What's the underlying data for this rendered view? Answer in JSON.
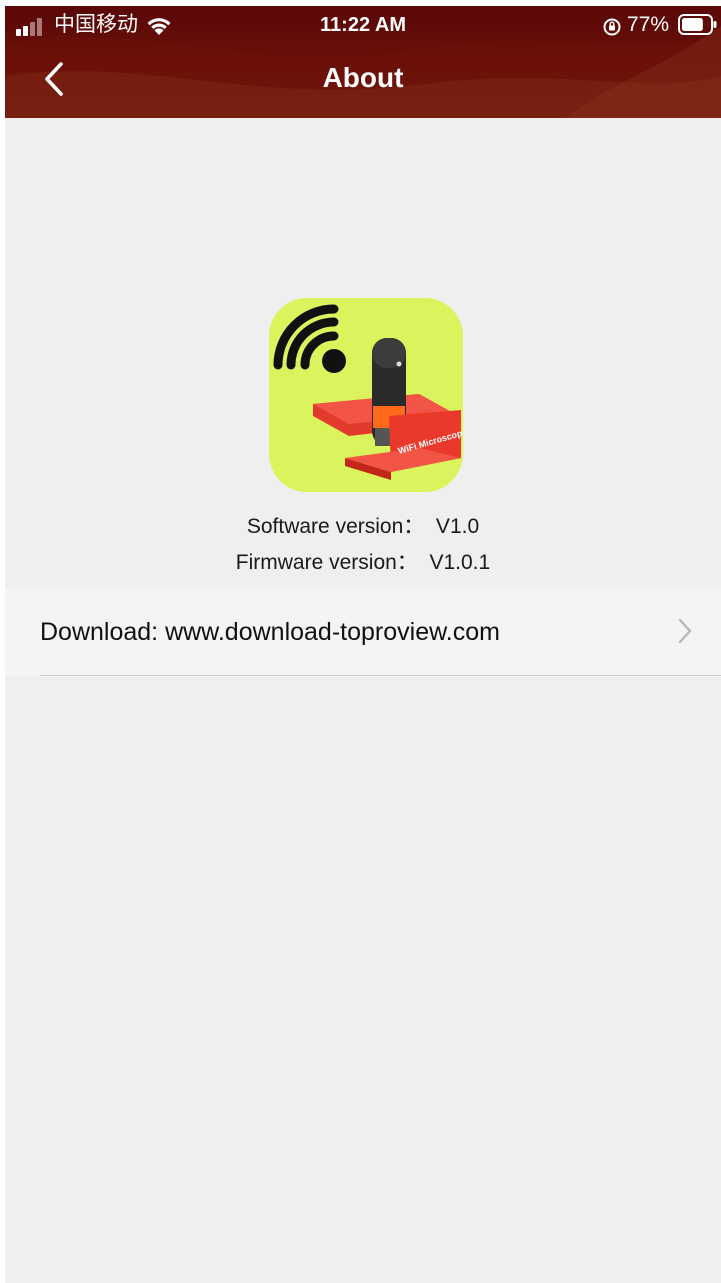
{
  "status_bar": {
    "carrier": "中国移动",
    "time": "11:22 AM",
    "battery_percent": "77%",
    "battery_level": 0.77,
    "icons": [
      "signal-icon",
      "wifi-icon",
      "orientation-lock-icon",
      "battery-icon"
    ]
  },
  "nav": {
    "title": "About",
    "back_icon": "chevron-left-icon"
  },
  "app_icon": {
    "name": "app-logo",
    "badge_text": "WiFi Microscope",
    "background": "#dbf35c"
  },
  "info": {
    "software_version": "Software version：  V1.0",
    "firmware_version": "Firmware version：  V1.0.1"
  },
  "download": {
    "label": "Download: www.download-toproview.com",
    "chevron_icon": "chevron-right-icon"
  },
  "colors": {
    "header_dark": "#5a0707",
    "header_light": "#7a2314",
    "background": "#efefef",
    "row": "#f4f4f5"
  }
}
